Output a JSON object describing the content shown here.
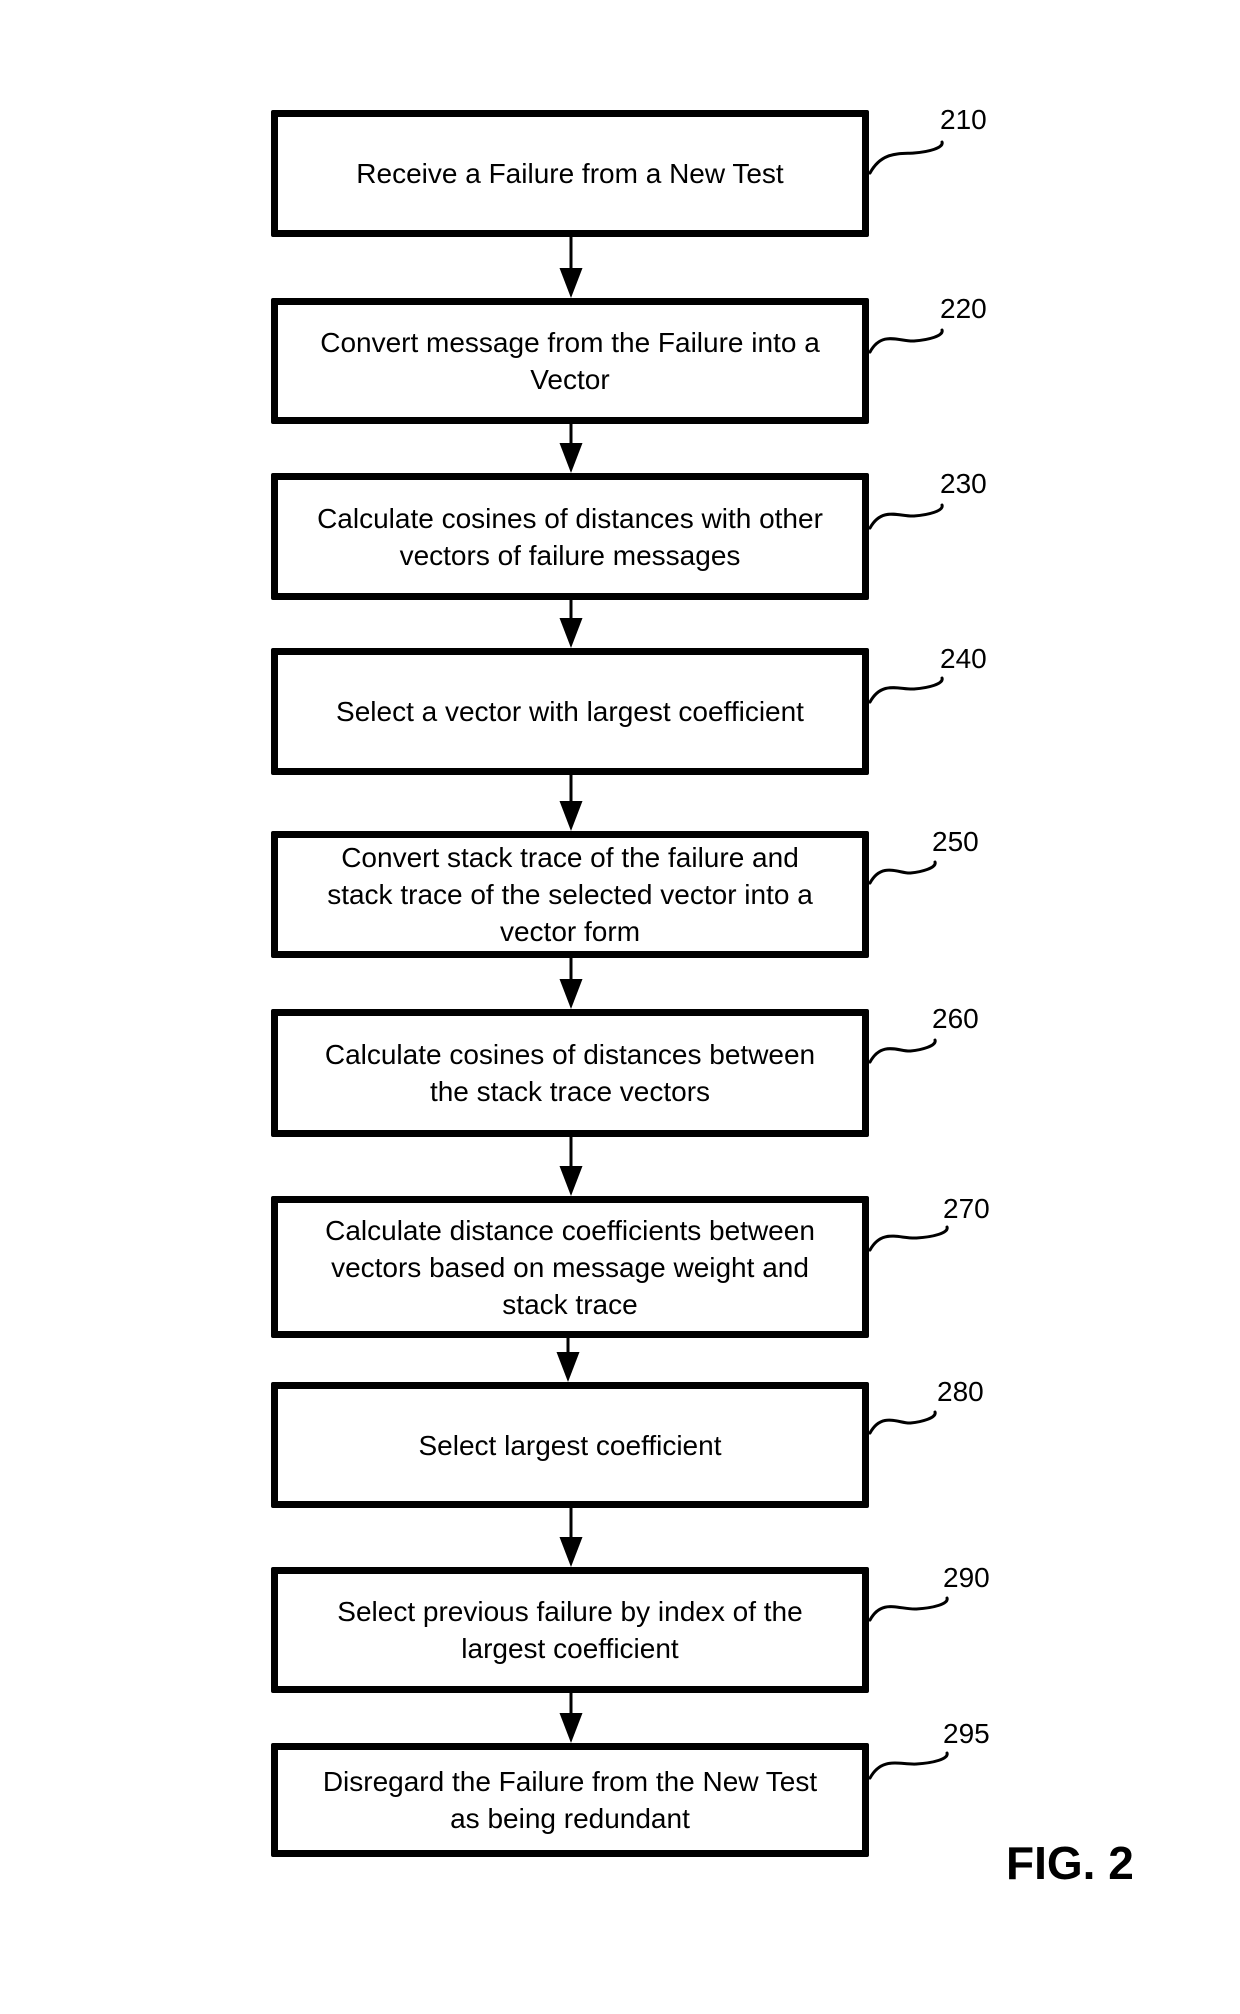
{
  "figure": {
    "label": "FIG. 2",
    "type": "flowchart"
  },
  "steps": [
    {
      "ref": "210",
      "text": "Receive a Failure from a New Test"
    },
    {
      "ref": "220",
      "text": "Convert message from the Failure into a\nVector"
    },
    {
      "ref": "230",
      "text": "Calculate cosines of distances with other\nvectors of failure messages"
    },
    {
      "ref": "240",
      "text": "Select a vector with largest coefficient"
    },
    {
      "ref": "250",
      "text": "Convert stack trace of the failure and\nstack trace of the selected vector into a\nvector form"
    },
    {
      "ref": "260",
      "text": "Calculate cosines of distances between\nthe stack trace vectors"
    },
    {
      "ref": "270",
      "text": "Calculate distance coefficients between\nvectors based on message weight and\nstack trace"
    },
    {
      "ref": "280",
      "text": "Select largest coefficient"
    },
    {
      "ref": "290",
      "text": "Select previous failure by index of the\nlargest coefficient"
    },
    {
      "ref": "295",
      "text": "Disregard the Failure from the New Test\nas being redundant"
    }
  ],
  "edges": [
    {
      "from": "210",
      "to": "220"
    },
    {
      "from": "220",
      "to": "230"
    },
    {
      "from": "230",
      "to": "240"
    },
    {
      "from": "240",
      "to": "250"
    },
    {
      "from": "250",
      "to": "260"
    },
    {
      "from": "260",
      "to": "270"
    },
    {
      "from": "270",
      "to": "280"
    },
    {
      "from": "280",
      "to": "290"
    },
    {
      "from": "290",
      "to": "295"
    }
  ],
  "colors": {
    "stroke": "#000000",
    "background": "#ffffff"
  }
}
